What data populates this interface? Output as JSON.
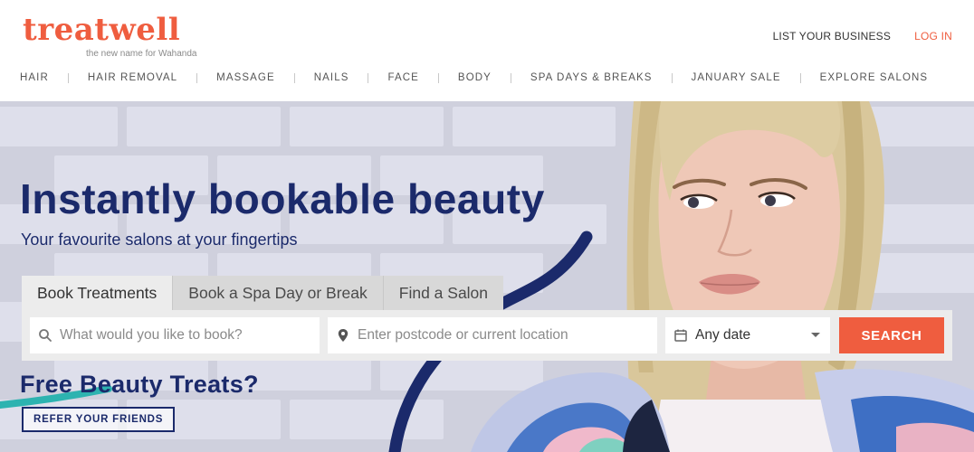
{
  "brand": {
    "logo_text": "treatwell",
    "tagline": "the new name for Wahanda",
    "accent_color": "#ef5d3f",
    "navy_color": "#1b2a6b"
  },
  "top_links": {
    "list_business": "LIST YOUR BUSINESS",
    "login": "LOG IN"
  },
  "nav": {
    "items": [
      {
        "label": "HAIR"
      },
      {
        "label": "HAIR REMOVAL"
      },
      {
        "label": "MASSAGE"
      },
      {
        "label": "NAILS"
      },
      {
        "label": "FACE"
      },
      {
        "label": "BODY"
      },
      {
        "label": "SPA DAYS & BREAKS"
      },
      {
        "label": "JANUARY SALE"
      },
      {
        "label": "EXPLORE SALONS"
      }
    ]
  },
  "hero": {
    "title": "Instantly bookable beauty",
    "subtitle": "Your favourite salons at your fingertips"
  },
  "search": {
    "tabs": [
      {
        "label": "Book Treatments",
        "active": true
      },
      {
        "label": "Book a Spa Day or Break",
        "active": false
      },
      {
        "label": "Find a Salon",
        "active": false
      }
    ],
    "treatment_placeholder": "What would you like to book?",
    "location_placeholder": "Enter postcode or current location",
    "date_value": "Any date",
    "button_label": "SEARCH",
    "icons": {
      "treatment": "search-icon",
      "location": "map-pin-icon",
      "date": "calendar-icon",
      "dropdown": "chevron-down-icon"
    }
  },
  "promo": {
    "title": "Free Beauty Treats?",
    "button_label": "REFER YOUR FRIENDS"
  }
}
